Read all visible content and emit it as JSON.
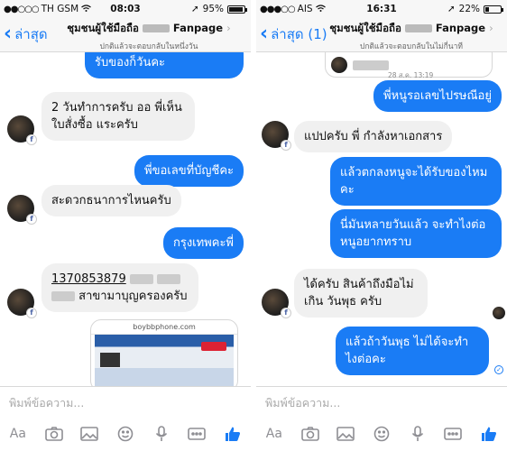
{
  "left": {
    "status": {
      "carrier": "TH GSM",
      "time": "08:03",
      "battery_text": "95%",
      "battery_level": 0.95
    },
    "nav": {
      "back_label": "ล่าสุด",
      "title": "ชุมชนผู้ใช้มือถือ",
      "title_suffix": "Fanpage",
      "subtitle": "ปกติแล้วจะตอบกลับในหนึ่งวัน"
    },
    "messages": {
      "m0": "รับของก็วันคะ",
      "m1": "2 วันทำการครับ ออ  พี่เห็นใบสั่งซื้อ แระครับ",
      "m2": "พี่ขอเลขที่บัญชีคะ",
      "m3": "สะดวกธนาการไหนครับ",
      "m4": "กรุงเทพคะพี่",
      "m5_number": "1370853879",
      "m5_text": "สาขามาบุญครองครับ"
    },
    "share_card": {
      "site": "boybbphone.com"
    },
    "composer": {
      "placeholder": "พิมพ์ข้อความ...",
      "aa_label": "Aa"
    }
  },
  "right": {
    "status": {
      "carrier": "AIS",
      "time": "16:31",
      "battery_text": "22%",
      "battery_level": 0.22
    },
    "nav": {
      "back_label": "ล่าสุด (1)",
      "title": "ชุมชนผู้ใช้มือถือ",
      "title_suffix": "Fanpage",
      "subtitle": "ปกติแล้วจะตอบกลับในไม่กี่นาที"
    },
    "card_timestamp": "28 ส.ค. 13:19",
    "messages": {
      "m0": "พี่หนูรอเลขไปรษณีอยู่",
      "m1": "แปปครับ พี่ กำลังหาเอกสาร",
      "m2": "แล้วตกลงหนูจะได้รับของไหมคะ",
      "m3": "นี่มันหลายวันแล้ว จะทำไงต่อ หนูอยากทราบ",
      "m4": "ได้ครับ สินค้าถึงมือไม่เกิน วันพุธ ครับ",
      "m5": "แล้วถ้าวันพุธ ไม่ได้จะทำไงต่อคะ"
    },
    "composer": {
      "placeholder": "พิมพ์ข้อความ...",
      "aa_label": "Aa"
    }
  },
  "colors": {
    "accent": "#1a7cf5",
    "incoming_bubble": "#f0f0f0",
    "outgoing_text": "#ffffff"
  }
}
